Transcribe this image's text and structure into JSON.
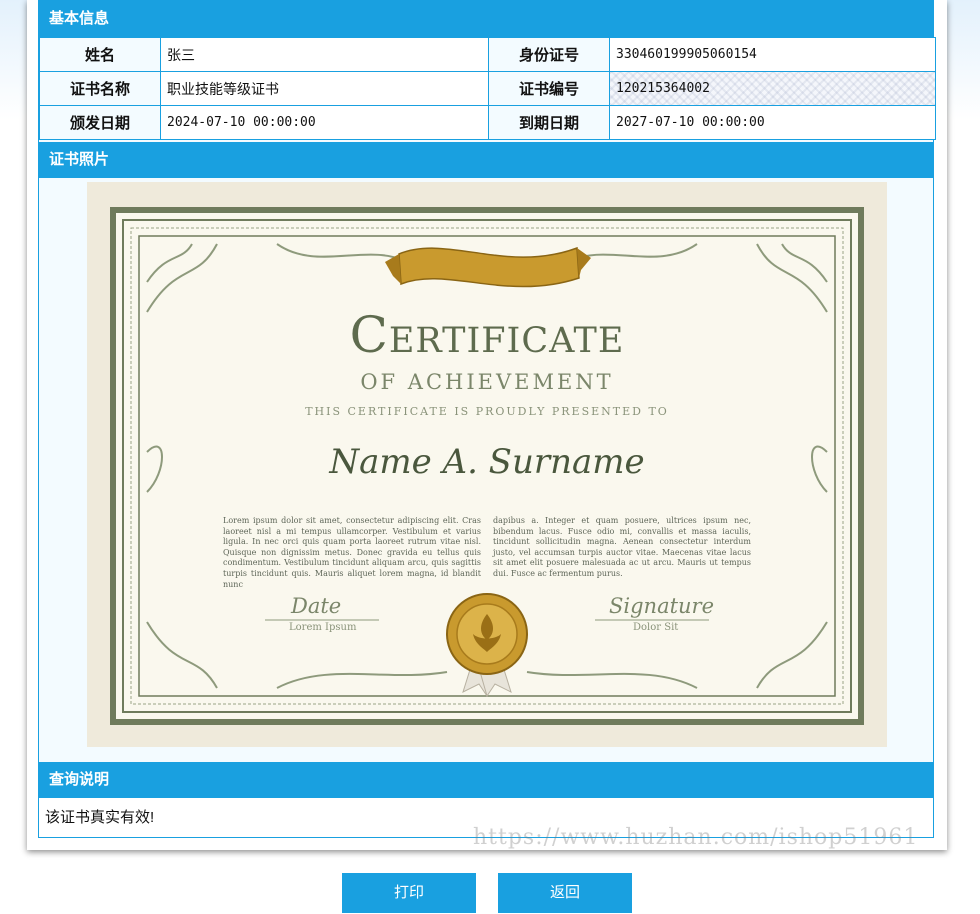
{
  "basic_info": {
    "header": "基本信息",
    "name_label": "姓名",
    "name_value": "张三",
    "id_label": "身份证号",
    "id_value": "330460199905060154",
    "cert_name_label": "证书名称",
    "cert_name_value": "职业技能等级证书",
    "cert_no_label": "证书编号",
    "cert_no_value": "120215364002",
    "issue_label": "颁发日期",
    "issue_value": "2024-07-10 00:00:00",
    "expire_label": "到期日期",
    "expire_value": "2027-07-10 00:00:00"
  },
  "photo": {
    "header": "证书照片",
    "title": "Certificate",
    "subtitle": "OF ACHIEVEMENT",
    "presented": "THIS CERTIFICATE IS PROUDLY PRESENTED TO",
    "recipient": "Name A. Surname",
    "lorem_left": "Lorem ipsum dolor sit amet, consectetur adipiscing elit. Cras laoreet nisl a mi tempus ullamcorper. Vestibulum et varius ligula. In nec orci quis quam porta laoreet rutrum vitae nisl. Quisque non dignissim metus. Donec gravida eu tellus quis condimentum. Vestibulum tincidunt aliquam arcu, quis sagittis turpis tincidunt quis. Mauris aliquet lorem magna, id blandit nunc",
    "lorem_right": "dapibus a. Integer et quam posuere, ultrices ipsum nec, bibendum lacus. Fusce odio mi, convallis et massa iaculis, tincidunt sollicitudin magna. Aenean consectetur interdum justo, vel accumsan turpis auctor vitae. Maecenas vitae lacus sit amet elit posuere malesuada ac ut arcu. Mauris ut tempus dui. Fusce ac fermentum purus.",
    "date_label": "Date",
    "date_sub": "Lorem Ipsum",
    "signature_label": "Signature",
    "signature_sub": "Dolor Sit",
    "colors": {
      "frame": "#6f7b5c",
      "paper": "#faf8ee",
      "gold": "#c99a2e"
    }
  },
  "explain": {
    "header": "查询说明",
    "text": "该证书真实有效!"
  },
  "watermark": "https://www.huzhan.com/ishop51961",
  "buttons": {
    "print": "打印",
    "back": "返回"
  },
  "colors": {
    "accent": "#19a0e0",
    "panel_bg": "#f3fbff"
  }
}
